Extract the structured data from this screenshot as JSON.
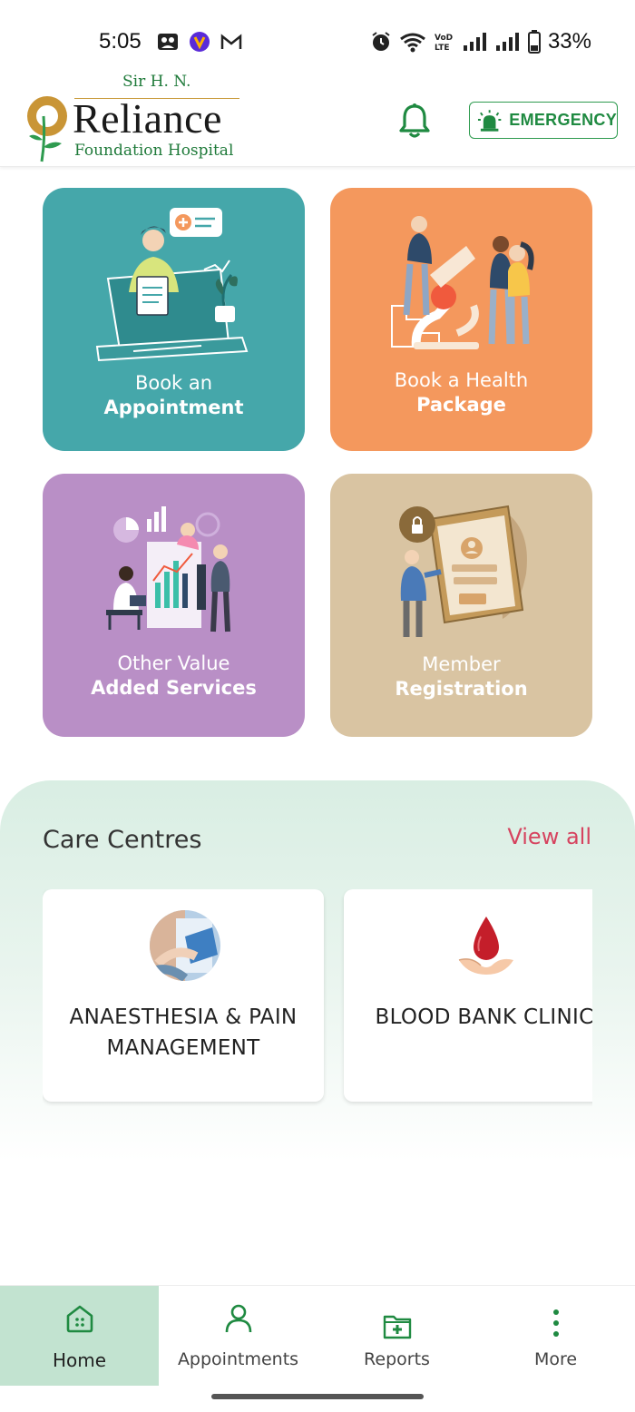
{
  "status_bar": {
    "time": "5:05",
    "battery_percent": "33%",
    "icons": [
      "photos-icon",
      "app-icon",
      "gmail-icon",
      "alarm-icon",
      "wifi-icon",
      "volte-icon",
      "signal-icon",
      "signal-icon",
      "battery-icon"
    ]
  },
  "header": {
    "logo": {
      "prefix": "Sir H. N.",
      "name": "Reliance",
      "subtitle": "Foundation Hospital"
    },
    "notification_icon": "bell-icon",
    "emergency_label": "EMERGENCY"
  },
  "tiles": [
    {
      "line1": "Book an",
      "line2": "Appointment",
      "color": "#45a7aa"
    },
    {
      "line1": "Book a Health",
      "line2": "Package",
      "color": "#f4985d"
    },
    {
      "line1": "Other Value",
      "line2": "Added Services",
      "color": "#b98fc6"
    },
    {
      "line1": "Member",
      "line2": "Registration",
      "color": "#d9c4a2"
    }
  ],
  "care_centres": {
    "title": "Care Centres",
    "view_all": "View all",
    "items": [
      {
        "label": "ANAESTHESIA & PAIN MANAGEMENT",
        "icon": "anaesthesia-photo-icon"
      },
      {
        "label": "BLOOD BANK CLINIC",
        "icon": "blood-drop-icon"
      }
    ]
  },
  "bottom_nav": {
    "items": [
      {
        "label": "Home",
        "icon": "home-icon",
        "active": true
      },
      {
        "label": "Appointments",
        "icon": "person-icon",
        "active": false
      },
      {
        "label": "Reports",
        "icon": "reports-folder-icon",
        "active": false
      },
      {
        "label": "More",
        "icon": "more-vertical-icon",
        "active": false
      }
    ]
  },
  "colors": {
    "brand_green": "#1f8a41",
    "accent_pink": "#d6435f",
    "active_tab": "#c2e3d0"
  }
}
